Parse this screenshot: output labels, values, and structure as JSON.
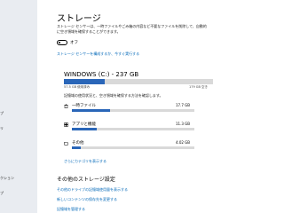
{
  "sidebar": {
    "items": [
      {
        "label": "プ"
      },
      {
        "label": "リ"
      },
      {
        "label": "クション"
      },
      {
        "label": "プ"
      }
    ]
  },
  "page": {
    "title": "ストレージ",
    "description": "ストレージ センサーは、一時ファイルやごみ箱の内容など不要なファイルを削除して、自動的に空き領域を確保することができます。",
    "toggle_label": "オフ",
    "configure_link": "ストレージ センサーを構成するか、今すぐ実行する"
  },
  "drive": {
    "title": "WINDOWS (C:) - 237 GB",
    "used_label": "57.5 GB 使用済み",
    "free_label": "179 GB 空き",
    "used_fraction": 0.243,
    "note": "記憶域の使用状況と、空き領域を確保する方法を確認します。",
    "categories": [
      {
        "name": "一時ファイル",
        "size": "17.7 GB",
        "icon": "trash-icon",
        "fraction": 0.31
      },
      {
        "name": "アプリと機能",
        "size": "11.3 GB",
        "icon": "apps-icon",
        "fraction": 0.2
      },
      {
        "name": "その他",
        "size": "4.02 GB",
        "icon": "folder-icon",
        "fraction": 0.07
      }
    ],
    "show_more_link": "さらにカテゴリを表示する"
  },
  "more_settings": {
    "title": "その他のストレージ設定",
    "links": [
      "その他のドライブの記憶域使用量を表示する",
      "新しいコンテンツの保存先を変更する",
      "記憶域を管理する"
    ]
  },
  "colors": {
    "accent": "#2a66b8",
    "link": "#0067b8",
    "bar_bg": "#d9d9d9"
  }
}
